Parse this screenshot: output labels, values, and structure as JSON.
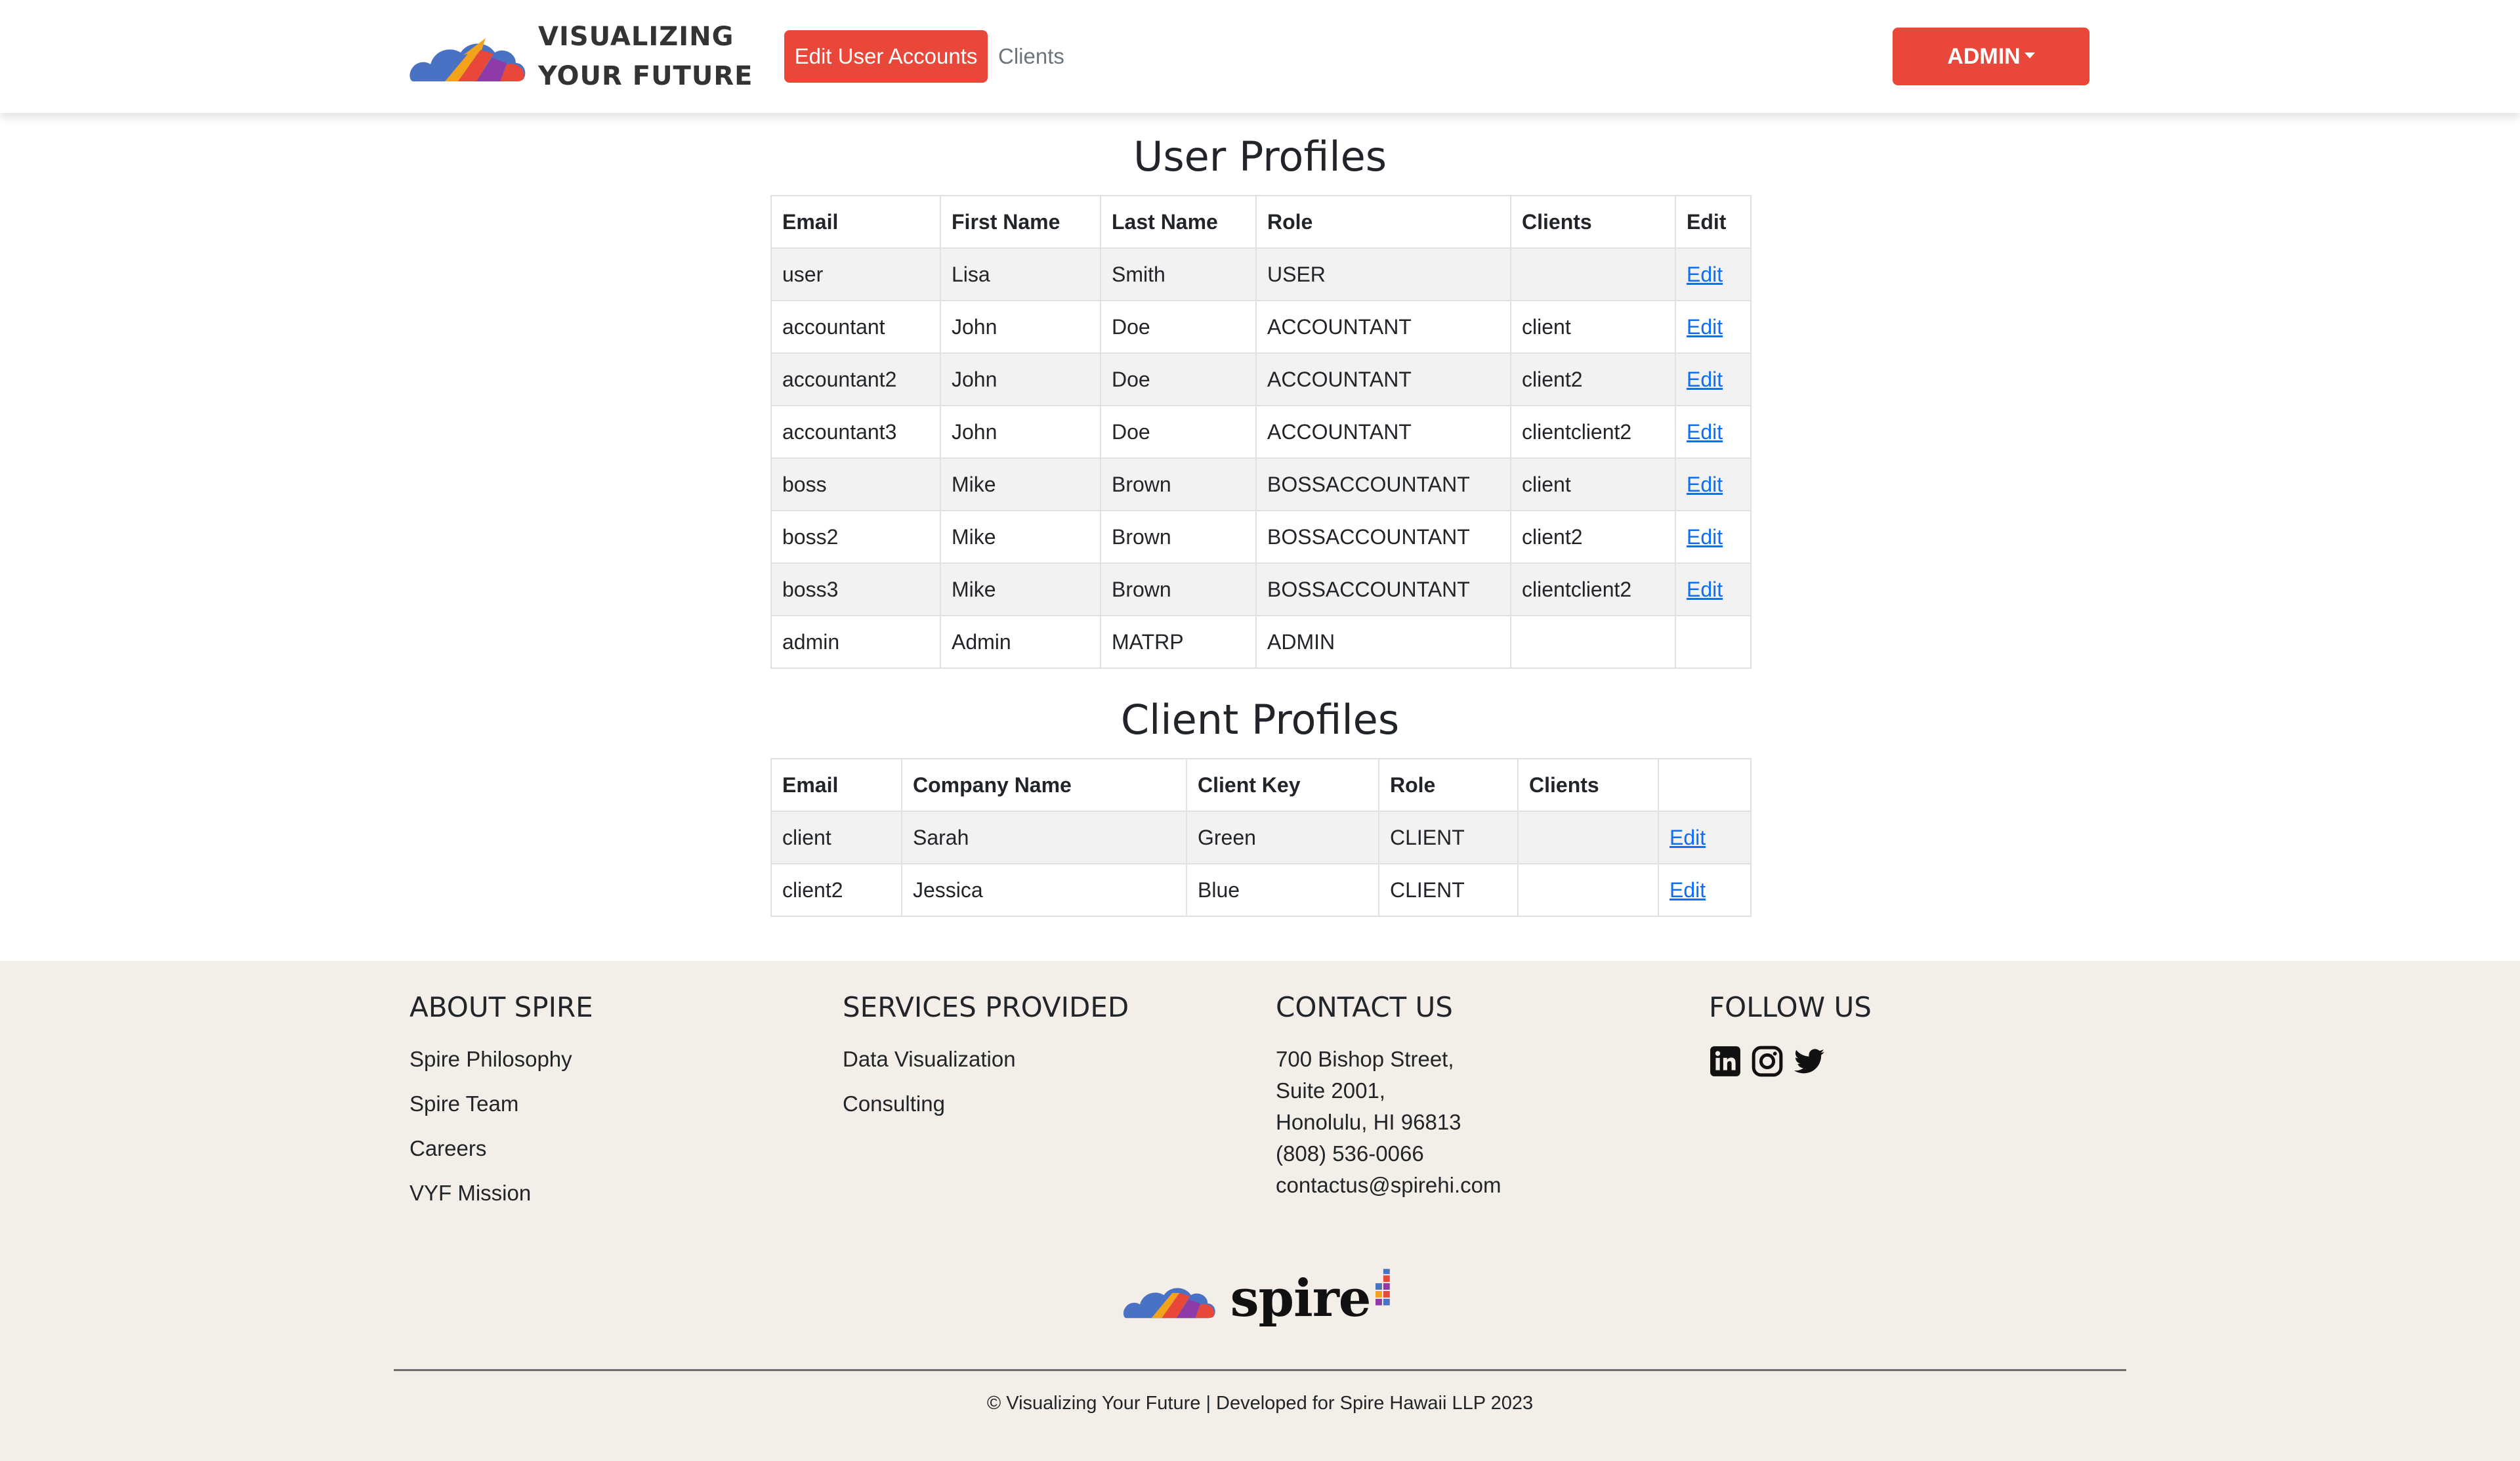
{
  "brand": {
    "line1": "VISUALIZING",
    "line2": "YOUR FUTURE"
  },
  "nav": {
    "edit_accounts": "Edit User Accounts",
    "clients": "Clients",
    "admin": "ADMIN"
  },
  "user_profiles": {
    "title": "User Profiles",
    "headers": [
      "Email",
      "First Name",
      "Last Name",
      "Role",
      "Clients",
      "Edit"
    ],
    "rows": [
      {
        "email": "user",
        "first": "Lisa",
        "last": "Smith",
        "role": "USER",
        "clients": "",
        "edit": "Edit"
      },
      {
        "email": "accountant",
        "first": "John",
        "last": "Doe",
        "role": "ACCOUNTANT",
        "clients": "client",
        "edit": "Edit"
      },
      {
        "email": "accountant2",
        "first": "John",
        "last": "Doe",
        "role": "ACCOUNTANT",
        "clients": "client2",
        "edit": "Edit"
      },
      {
        "email": "accountant3",
        "first": "John",
        "last": "Doe",
        "role": "ACCOUNTANT",
        "clients": "clientclient2",
        "edit": "Edit"
      },
      {
        "email": "boss",
        "first": "Mike",
        "last": "Brown",
        "role": "BOSSACCOUNTANT",
        "clients": "client",
        "edit": "Edit"
      },
      {
        "email": "boss2",
        "first": "Mike",
        "last": "Brown",
        "role": "BOSSACCOUNTANT",
        "clients": "client2",
        "edit": "Edit"
      },
      {
        "email": "boss3",
        "first": "Mike",
        "last": "Brown",
        "role": "BOSSACCOUNTANT",
        "clients": "clientclient2",
        "edit": "Edit"
      },
      {
        "email": "admin",
        "first": "Admin",
        "last": "MATRP",
        "role": "ADMIN",
        "clients": "",
        "edit": ""
      }
    ]
  },
  "client_profiles": {
    "title": "Client Profiles",
    "headers": [
      "Email",
      "Company Name",
      "Client Key",
      "Role",
      "Clients",
      ""
    ],
    "rows": [
      {
        "email": "client",
        "company": "Sarah",
        "key": "Green",
        "role": "CLIENT",
        "clients": "",
        "edit": "Edit"
      },
      {
        "email": "client2",
        "company": "Jessica",
        "key": "Blue",
        "role": "CLIENT",
        "clients": "",
        "edit": "Edit"
      }
    ]
  },
  "footer": {
    "about": {
      "title": "ABOUT SPIRE",
      "links": [
        "Spire Philosophy",
        "Spire Team",
        "Careers",
        "VYF Mission"
      ]
    },
    "services": {
      "title": "SERVICES PROVIDED",
      "links": [
        "Data Visualization",
        "Consulting"
      ]
    },
    "contact": {
      "title": "CONTACT US",
      "lines": [
        "700 Bishop Street,",
        "Suite 2001,",
        "Honolulu, HI 96813",
        "(808) 536-0066",
        "contactus@spirehi.com"
      ]
    },
    "follow": {
      "title": "FOLLOW US",
      "icons": [
        "linkedin-icon",
        "instagram-icon",
        "twitter-icon"
      ]
    },
    "logo_text": "spire",
    "copyright": "© Visualizing Your Future | Developed for Spire Hawaii LLP 2023"
  },
  "colors": {
    "accent": "#e8473a",
    "footer_bg": "#f3eee7",
    "link": "#0d6efd"
  }
}
